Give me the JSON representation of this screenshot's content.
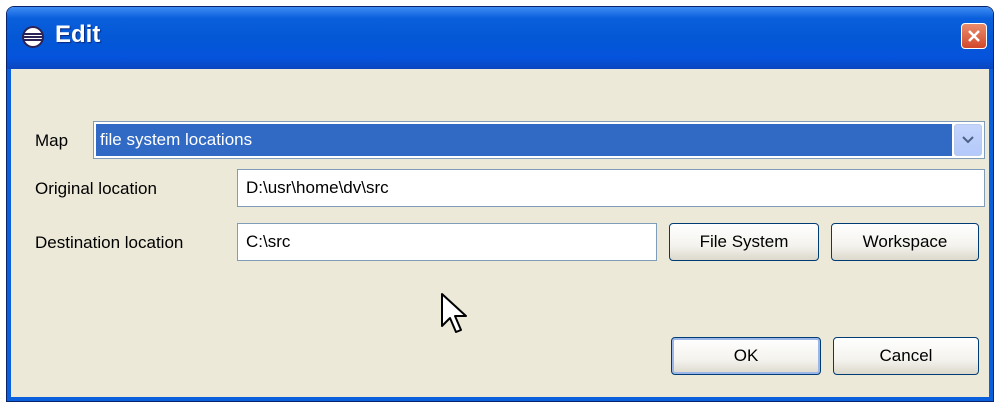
{
  "window": {
    "title": "Edit",
    "close_icon": "close-icon"
  },
  "form": {
    "map_label": "Map",
    "map_value": "file system locations",
    "original_label": "Original location",
    "original_value": "D:\\usr\\home\\dv\\src",
    "destination_label": "Destination location",
    "destination_value": "C:\\src",
    "file_system_button": "File System",
    "workspace_button": "Workspace"
  },
  "buttons": {
    "ok": "OK",
    "cancel": "Cancel"
  },
  "colors": {
    "titlebar": "#0458d6",
    "selection": "#316ac5",
    "dialog_bg": "#ece9d8"
  }
}
